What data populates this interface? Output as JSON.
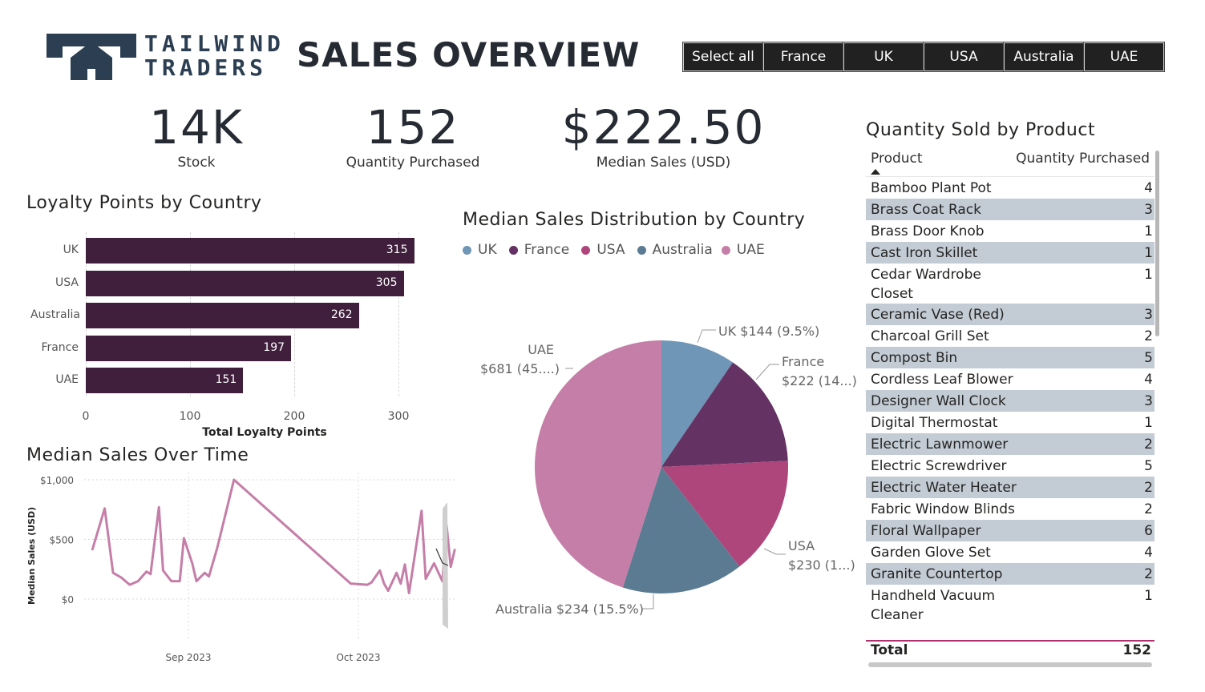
{
  "header": {
    "logo_text_line1": "TAILWIND",
    "logo_text_line2": "TRADERS",
    "title": "SALES OVERVIEW"
  },
  "slicer": {
    "options": [
      "Select all",
      "France",
      "UK",
      "USA",
      "Australia",
      "UAE"
    ]
  },
  "kpis": [
    {
      "value": "14K",
      "label": "Stock"
    },
    {
      "value": "152",
      "label": "Quantity Purchased"
    },
    {
      "value": "$222.50",
      "label": "Median Sales (USD)"
    }
  ],
  "loyalty_chart": {
    "title": "Loyalty Points by Country",
    "xlabel": "Total Loyalty Points"
  },
  "time_chart": {
    "title": "Median Sales Over Time",
    "ylabel": "Median Sales (USD)"
  },
  "pie_chart": {
    "title": "Median Sales Distribution by Country",
    "labels": {
      "uk": "UK $144 (9.5%)",
      "france_line1": "France",
      "france_line2": "$222 (14...)",
      "usa_line1": "USA",
      "usa_line2": "$230 (1...)",
      "australia": "Australia $234 (15.5%)",
      "uae_line1": "UAE",
      "uae_line2": "$681 (45....)"
    }
  },
  "product_table": {
    "title": "Quantity Sold by Product",
    "col_product": "Product",
    "col_qty": "Quantity Purchased",
    "rows": [
      {
        "product": "Bamboo Plant Pot",
        "qty": "4"
      },
      {
        "product": "Brass Coat Rack",
        "qty": "3"
      },
      {
        "product": "Brass Door Knob",
        "qty": "1"
      },
      {
        "product": "Cast Iron Skillet",
        "qty": "1"
      },
      {
        "product": "Cedar Wardrobe Closet",
        "qty": "1"
      },
      {
        "product": "Ceramic Vase (Red)",
        "qty": "3"
      },
      {
        "product": "Charcoal Grill Set",
        "qty": "2"
      },
      {
        "product": "Compost Bin",
        "qty": "5"
      },
      {
        "product": "Cordless Leaf Blower",
        "qty": "4"
      },
      {
        "product": "Designer Wall Clock",
        "qty": "3"
      },
      {
        "product": "Digital Thermostat",
        "qty": "1"
      },
      {
        "product": "Electric Lawnmower",
        "qty": "2"
      },
      {
        "product": "Electric Screwdriver",
        "qty": "5"
      },
      {
        "product": "Electric Water Heater",
        "qty": "2"
      },
      {
        "product": "Fabric Window Blinds",
        "qty": "2"
      },
      {
        "product": "Floral Wallpaper",
        "qty": "6"
      },
      {
        "product": "Garden Glove Set",
        "qty": "4"
      },
      {
        "product": "Granite Countertop",
        "qty": "2"
      },
      {
        "product": "Handheld Vacuum Cleaner",
        "qty": "1"
      }
    ],
    "total_label": "Total",
    "total_value": "152"
  },
  "colors": {
    "bar": "#3f1f3c",
    "uk": "#6f96b6",
    "france": "#643363",
    "usa": "#ae467c",
    "australia": "#5b7b93",
    "uae": "#c57ea7",
    "line": "#c57ea7"
  },
  "chart_data": [
    {
      "type": "bar",
      "title": "Loyalty Points by Country",
      "categories": [
        "UK",
        "USA",
        "Australia",
        "France",
        "UAE"
      ],
      "values": [
        315,
        305,
        262,
        197,
        151
      ],
      "xlabel": "Total Loyalty Points",
      "xticks": [
        "0",
        "100",
        "200",
        "300"
      ],
      "xlim": [
        0,
        340
      ]
    },
    {
      "type": "line",
      "title": "Median Sales Over Time",
      "ylabel": "Median Sales (USD)",
      "yticks": [
        "$0",
        "$500",
        "$1,000"
      ],
      "ylim": [
        0,
        1000
      ],
      "xticks": [
        "Sep 2023",
        "Oct 2023"
      ],
      "x_day_offsets": [
        0,
        3,
        5,
        7,
        9,
        11,
        13,
        14,
        16,
        17,
        19,
        21,
        22,
        24,
        25,
        27,
        28,
        30,
        34,
        62,
        66,
        67,
        69,
        70,
        71,
        73,
        74,
        75,
        76,
        77,
        79,
        80,
        82,
        84,
        85,
        86,
        87
      ],
      "values": [
        410,
        760,
        220,
        180,
        120,
        150,
        230,
        210,
        770,
        240,
        150,
        150,
        510,
        300,
        150,
        220,
        190,
        430,
        1000,
        130,
        120,
        140,
        240,
        130,
        70,
        220,
        130,
        290,
        50,
        280,
        740,
        170,
        300,
        150,
        620,
        270,
        420
      ]
    },
    {
      "type": "pie",
      "title": "Median Sales Distribution by Country",
      "categories": [
        "UK",
        "France",
        "USA",
        "Australia",
        "UAE"
      ],
      "values": [
        144,
        222,
        230,
        234,
        681
      ],
      "percent_labels": [
        "9.5%",
        "14...",
        "1...",
        "15.5%",
        "45...."
      ]
    }
  ]
}
